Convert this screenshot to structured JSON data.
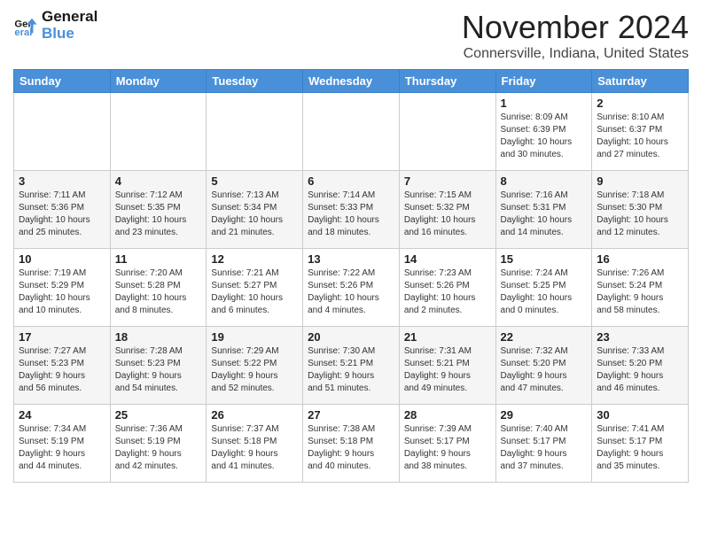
{
  "logo": {
    "line1": "General",
    "line2": "Blue"
  },
  "header": {
    "month": "November 2024",
    "location": "Connersville, Indiana, United States"
  },
  "weekdays": [
    "Sunday",
    "Monday",
    "Tuesday",
    "Wednesday",
    "Thursday",
    "Friday",
    "Saturday"
  ],
  "weeks": [
    [
      {
        "day": "",
        "info": ""
      },
      {
        "day": "",
        "info": ""
      },
      {
        "day": "",
        "info": ""
      },
      {
        "day": "",
        "info": ""
      },
      {
        "day": "",
        "info": ""
      },
      {
        "day": "1",
        "info": "Sunrise: 8:09 AM\nSunset: 6:39 PM\nDaylight: 10 hours\nand 30 minutes."
      },
      {
        "day": "2",
        "info": "Sunrise: 8:10 AM\nSunset: 6:37 PM\nDaylight: 10 hours\nand 27 minutes."
      }
    ],
    [
      {
        "day": "3",
        "info": "Sunrise: 7:11 AM\nSunset: 5:36 PM\nDaylight: 10 hours\nand 25 minutes."
      },
      {
        "day": "4",
        "info": "Sunrise: 7:12 AM\nSunset: 5:35 PM\nDaylight: 10 hours\nand 23 minutes."
      },
      {
        "day": "5",
        "info": "Sunrise: 7:13 AM\nSunset: 5:34 PM\nDaylight: 10 hours\nand 21 minutes."
      },
      {
        "day": "6",
        "info": "Sunrise: 7:14 AM\nSunset: 5:33 PM\nDaylight: 10 hours\nand 18 minutes."
      },
      {
        "day": "7",
        "info": "Sunrise: 7:15 AM\nSunset: 5:32 PM\nDaylight: 10 hours\nand 16 minutes."
      },
      {
        "day": "8",
        "info": "Sunrise: 7:16 AM\nSunset: 5:31 PM\nDaylight: 10 hours\nand 14 minutes."
      },
      {
        "day": "9",
        "info": "Sunrise: 7:18 AM\nSunset: 5:30 PM\nDaylight: 10 hours\nand 12 minutes."
      }
    ],
    [
      {
        "day": "10",
        "info": "Sunrise: 7:19 AM\nSunset: 5:29 PM\nDaylight: 10 hours\nand 10 minutes."
      },
      {
        "day": "11",
        "info": "Sunrise: 7:20 AM\nSunset: 5:28 PM\nDaylight: 10 hours\nand 8 minutes."
      },
      {
        "day": "12",
        "info": "Sunrise: 7:21 AM\nSunset: 5:27 PM\nDaylight: 10 hours\nand 6 minutes."
      },
      {
        "day": "13",
        "info": "Sunrise: 7:22 AM\nSunset: 5:26 PM\nDaylight: 10 hours\nand 4 minutes."
      },
      {
        "day": "14",
        "info": "Sunrise: 7:23 AM\nSunset: 5:26 PM\nDaylight: 10 hours\nand 2 minutes."
      },
      {
        "day": "15",
        "info": "Sunrise: 7:24 AM\nSunset: 5:25 PM\nDaylight: 10 hours\nand 0 minutes."
      },
      {
        "day": "16",
        "info": "Sunrise: 7:26 AM\nSunset: 5:24 PM\nDaylight: 9 hours\nand 58 minutes."
      }
    ],
    [
      {
        "day": "17",
        "info": "Sunrise: 7:27 AM\nSunset: 5:23 PM\nDaylight: 9 hours\nand 56 minutes."
      },
      {
        "day": "18",
        "info": "Sunrise: 7:28 AM\nSunset: 5:23 PM\nDaylight: 9 hours\nand 54 minutes."
      },
      {
        "day": "19",
        "info": "Sunrise: 7:29 AM\nSunset: 5:22 PM\nDaylight: 9 hours\nand 52 minutes."
      },
      {
        "day": "20",
        "info": "Sunrise: 7:30 AM\nSunset: 5:21 PM\nDaylight: 9 hours\nand 51 minutes."
      },
      {
        "day": "21",
        "info": "Sunrise: 7:31 AM\nSunset: 5:21 PM\nDaylight: 9 hours\nand 49 minutes."
      },
      {
        "day": "22",
        "info": "Sunrise: 7:32 AM\nSunset: 5:20 PM\nDaylight: 9 hours\nand 47 minutes."
      },
      {
        "day": "23",
        "info": "Sunrise: 7:33 AM\nSunset: 5:20 PM\nDaylight: 9 hours\nand 46 minutes."
      }
    ],
    [
      {
        "day": "24",
        "info": "Sunrise: 7:34 AM\nSunset: 5:19 PM\nDaylight: 9 hours\nand 44 minutes."
      },
      {
        "day": "25",
        "info": "Sunrise: 7:36 AM\nSunset: 5:19 PM\nDaylight: 9 hours\nand 42 minutes."
      },
      {
        "day": "26",
        "info": "Sunrise: 7:37 AM\nSunset: 5:18 PM\nDaylight: 9 hours\nand 41 minutes."
      },
      {
        "day": "27",
        "info": "Sunrise: 7:38 AM\nSunset: 5:18 PM\nDaylight: 9 hours\nand 40 minutes."
      },
      {
        "day": "28",
        "info": "Sunrise: 7:39 AM\nSunset: 5:17 PM\nDaylight: 9 hours\nand 38 minutes."
      },
      {
        "day": "29",
        "info": "Sunrise: 7:40 AM\nSunset: 5:17 PM\nDaylight: 9 hours\nand 37 minutes."
      },
      {
        "day": "30",
        "info": "Sunrise: 7:41 AM\nSunset: 5:17 PM\nDaylight: 9 hours\nand 35 minutes."
      }
    ]
  ]
}
